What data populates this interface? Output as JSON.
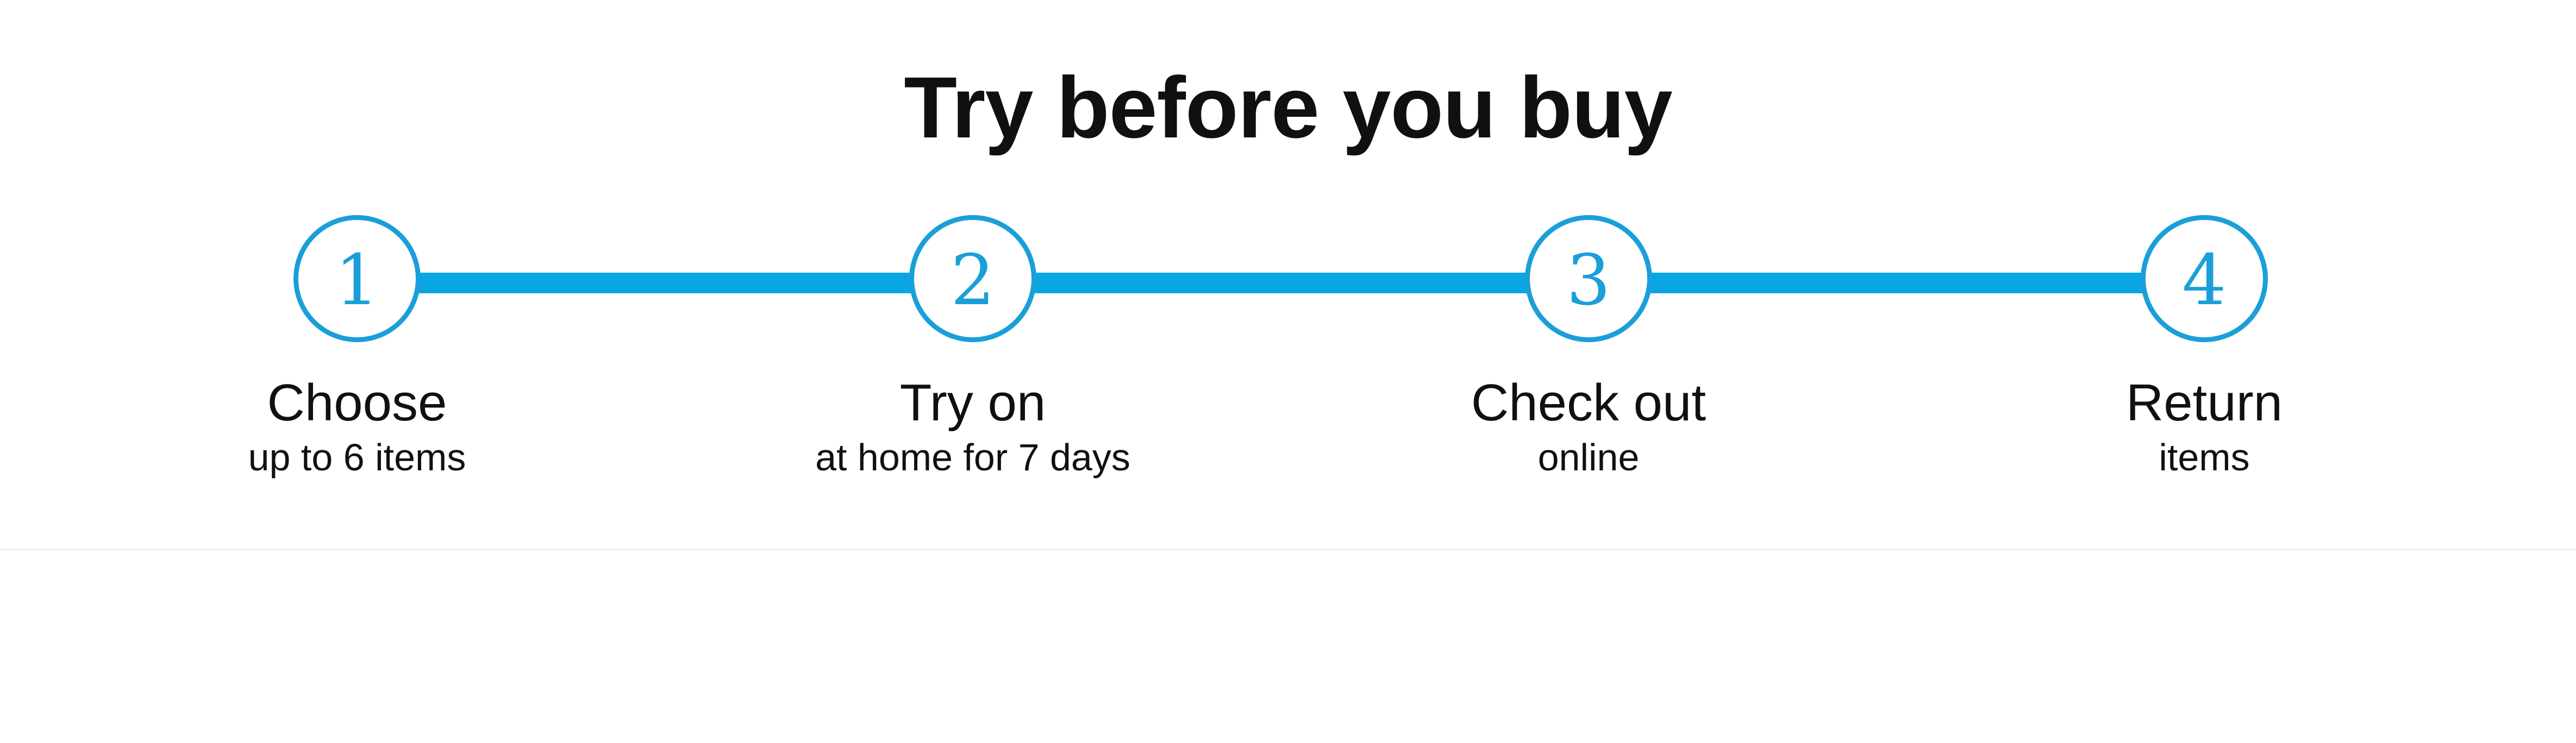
{
  "section": {
    "title": "Try before you buy"
  },
  "colors": {
    "accent": "#0aa6e3",
    "circle_border": "#1a9fd8",
    "text": "#0f1111",
    "divider": "#eeeeee"
  },
  "steps": [
    {
      "number": "1",
      "title": "Choose",
      "subtitle": "up to 6 items"
    },
    {
      "number": "2",
      "title": "Try on",
      "subtitle": "at home for 7 days"
    },
    {
      "number": "3",
      "title": "Check out",
      "subtitle": "online"
    },
    {
      "number": "4",
      "title": "Return",
      "subtitle": "items"
    }
  ]
}
